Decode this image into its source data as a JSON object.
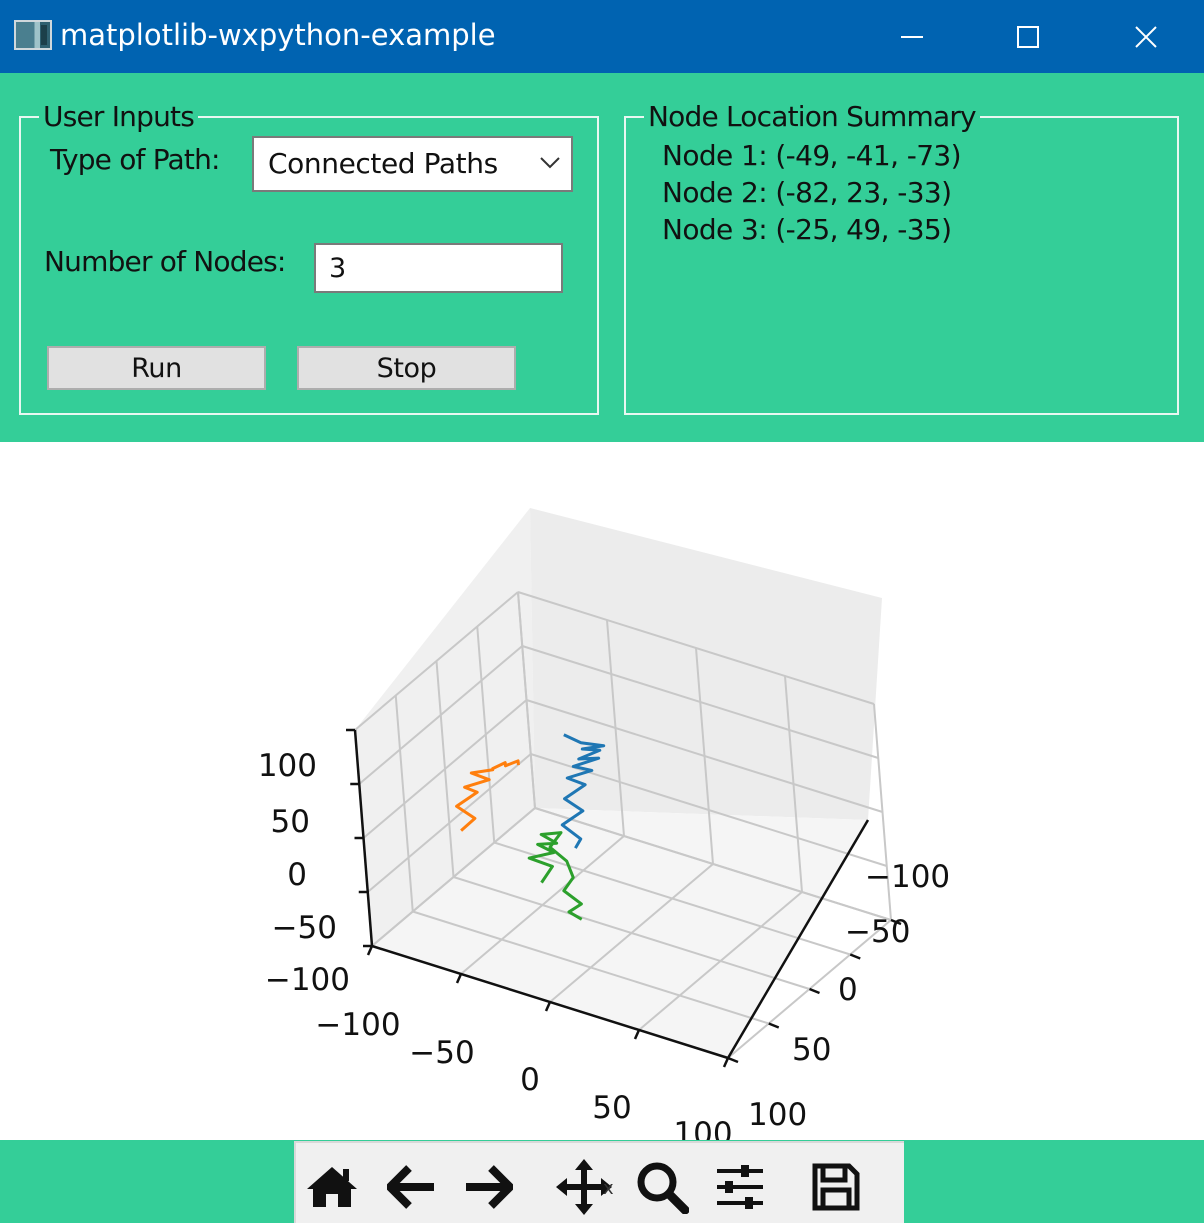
{
  "window": {
    "title": "matplotlib-wxpython-example",
    "icons": [
      "app-icon",
      "minimize-icon",
      "maximize-icon",
      "close-icon"
    ]
  },
  "user_inputs": {
    "legend": "User Inputs",
    "path_type_label": "Type of Path:",
    "path_type_value": "Connected Paths",
    "nodes_label": "Number of Nodes:",
    "nodes_value": "3",
    "run_label": "Run",
    "stop_label": "Stop"
  },
  "summary": {
    "legend": "Node Location Summary",
    "lines": [
      "Node 1: (-49, -41, -73)",
      "Node 2: (-82, 23, -33)",
      "Node 3: (-25, 49, -35)"
    ]
  },
  "chart_data": {
    "type": "line",
    "projection": "3d",
    "grid": true,
    "xlim": [
      -100,
      100
    ],
    "ylim": [
      -100,
      100
    ],
    "zlim": [
      -100,
      100
    ],
    "x_ticks": [
      "−100",
      "−50",
      "0",
      "50",
      "100"
    ],
    "y_ticks": [
      "−100",
      "−50",
      "0",
      "50",
      "100"
    ],
    "z_ticks": [
      "−100",
      "−50",
      "0",
      "50",
      "100"
    ],
    "series_colors": [
      "#1f77b4",
      "#ff7f0e",
      "#2ca02c"
    ],
    "series_paths": [
      [
        [
          -49,
          -41,
          -73
        ],
        [
          -44,
          -38,
          -60
        ],
        [
          -50,
          -30,
          -45
        ],
        [
          -40,
          -35,
          -30
        ],
        [
          -45,
          -25,
          -15
        ],
        [
          -35,
          -30,
          0
        ],
        [
          -40,
          -20,
          10
        ],
        [
          -28,
          -25,
          20
        ],
        [
          -32,
          -12,
          30
        ],
        [
          -20,
          -18,
          40
        ],
        [
          -25,
          -5,
          45
        ],
        [
          -15,
          -10,
          55
        ],
        [
          -20,
          0,
          60
        ],
        [
          -10,
          -5,
          65
        ],
        [
          -18,
          5,
          70
        ],
        [
          -30,
          0,
          68
        ]
      ],
      [
        [
          -82,
          23,
          -33
        ],
        [
          -75,
          20,
          -20
        ],
        [
          -80,
          30,
          -5
        ],
        [
          -70,
          25,
          10
        ],
        [
          -72,
          35,
          20
        ],
        [
          -60,
          30,
          30
        ],
        [
          -65,
          40,
          40
        ],
        [
          -55,
          35,
          45
        ],
        [
          -50,
          45,
          55
        ],
        [
          -45,
          40,
          60
        ],
        [
          -40,
          50,
          66
        ],
        [
          -35,
          45,
          70
        ],
        [
          -30,
          55,
          75
        ]
      ],
      [
        [
          -25,
          49,
          -35
        ],
        [
          -20,
          45,
          -20
        ],
        [
          -28,
          55,
          -10
        ],
        [
          -15,
          52,
          0
        ],
        [
          -20,
          60,
          10
        ],
        [
          -10,
          58,
          15
        ],
        [
          -15,
          65,
          25
        ],
        [
          -5,
          62,
          30
        ],
        [
          -8,
          70,
          20
        ],
        [
          0,
          68,
          10
        ],
        [
          5,
          72,
          0
        ],
        [
          2,
          78,
          -10
        ],
        [
          10,
          75,
          -20
        ],
        [
          6,
          82,
          -25
        ],
        [
          12,
          80,
          -30
        ]
      ]
    ]
  },
  "toolbar": {
    "tools": [
      "home-icon",
      "back-icon",
      "forward-icon",
      "pan-icon",
      "zoom-icon",
      "configure-subplots-icon",
      "save-icon"
    ],
    "more": "x"
  }
}
